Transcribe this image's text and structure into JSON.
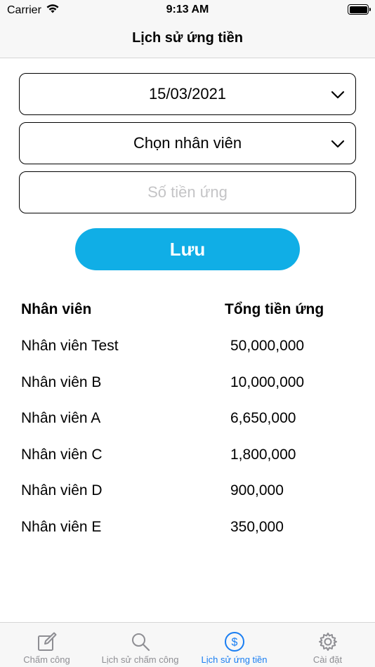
{
  "status_bar": {
    "carrier": "Carrier",
    "time": "9:13 AM"
  },
  "nav": {
    "title": "Lịch sử ứng tiền"
  },
  "form": {
    "date_value": "15/03/2021",
    "employee_value": "Chọn nhân viên",
    "amount_placeholder": "Số tiền ứng",
    "save_label": "Lưu"
  },
  "table": {
    "headers": {
      "employee": "Nhân viên",
      "total": "Tổng tiền ứng"
    },
    "rows": [
      {
        "name": "Nhân viên Test",
        "amount": "50,000,000"
      },
      {
        "name": "Nhân viên B",
        "amount": "10,000,000"
      },
      {
        "name": "Nhân viên A",
        "amount": "6,650,000"
      },
      {
        "name": "Nhân viên C",
        "amount": "1,800,000"
      },
      {
        "name": "Nhân viên D",
        "amount": "900,000"
      },
      {
        "name": "Nhân viên E",
        "amount": "350,000"
      }
    ]
  },
  "tabs": [
    {
      "label": "Chấm công",
      "icon": "compose-icon",
      "active": false
    },
    {
      "label": "Lịch sử chấm công",
      "icon": "search-icon",
      "active": false
    },
    {
      "label": "Lịch sử ứng tiền",
      "icon": "dollar-circle-icon",
      "active": true
    },
    {
      "label": "Cài đặt",
      "icon": "gear-icon",
      "active": false
    }
  ],
  "colors": {
    "accent": "#10aee6",
    "tab_active": "#1a7ef2",
    "tab_inactive": "#8e8e93"
  }
}
